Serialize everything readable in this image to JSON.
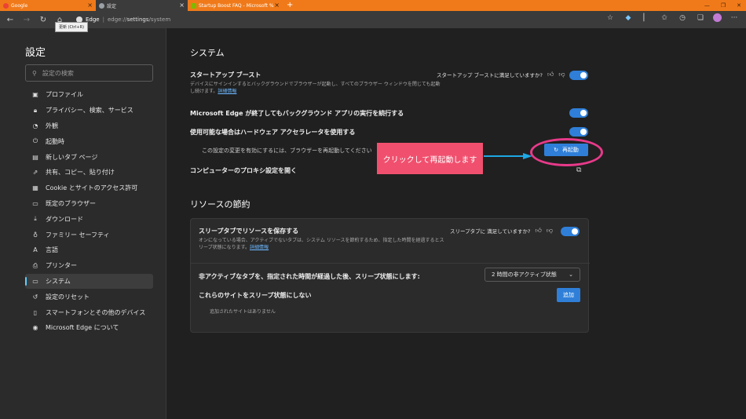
{
  "tabs": [
    {
      "label": "Google",
      "color": "#ea4335"
    },
    {
      "label": "設定",
      "color": "#9aa0a6"
    },
    {
      "label": "Startup Boost FAQ - Microsoft %",
      "color": "#7fba00"
    }
  ],
  "toolbar": {
    "tooltip": "更新 (Ctrl+R)",
    "brand": "Edge",
    "url_prefix": "edge://",
    "url_host": "settings",
    "url_path": "/system"
  },
  "sidebar": {
    "title": "設定",
    "search_placeholder": "設定の検索",
    "items": [
      {
        "label": "プロファイル"
      },
      {
        "label": "プライバシー、検索、サービス"
      },
      {
        "label": "外観"
      },
      {
        "label": "起動時"
      },
      {
        "label": "新しいタブ ページ"
      },
      {
        "label": "共有、コピー、貼り付け"
      },
      {
        "label": "Cookie とサイトのアクセス許可"
      },
      {
        "label": "既定のブラウザー"
      },
      {
        "label": "ダウンロード"
      },
      {
        "label": "ファミリー セーフティ"
      },
      {
        "label": "言語"
      },
      {
        "label": "プリンター"
      },
      {
        "label": "システム"
      },
      {
        "label": "設定のリセット"
      },
      {
        "label": "スマートフォンとその他のデバイス"
      },
      {
        "label": "Microsoft Edge について"
      }
    ]
  },
  "system": {
    "heading": "システム",
    "startup_boost_title": "スタートアップ ブースト",
    "startup_boost_desc1": "デバイスにサインインするとバックグラウンドでブラウザーが起動し、すべてのブラウザー ウィンドウを閉じても起動",
    "startup_boost_desc2": "し続けます。",
    "learn_more": "詳細情報",
    "startup_boost_feedback": "スタートアップ ブーストに満足していますか?",
    "background_title": "Microsoft Edge が終了してもバックグラウンド アプリの実行を続行する",
    "hw_accel_title": "使用可能な場合はハードウェア アクセラレータを使用する",
    "restart_note": "この設定の変更を有効にするには、ブラウザーを再起動してください",
    "restart_button": "再起動",
    "proxy_title": "コンピューターのプロキシ設定を開く"
  },
  "callout": "クリックして再起動します",
  "resources": {
    "heading": "リソースの節約",
    "sleeping_title": "スリープタブでリソースを保存する",
    "sleeping_desc1": "オンになっている場合、アクティブでないタブは、システム リソースを節約するため、指定した時間を経過するとス",
    "sleeping_desc2": "リープ状態になります。",
    "learn_more": "詳細情報",
    "sleeping_feedback": "スリープタブに 満足していますか?",
    "inactive_label": "非アクティブなタブを、指定された時間が経過した後、スリープ状態にします:",
    "inactive_value": "2 時間の非アクティブ状態",
    "never_sleep_label": "これらのサイトをスリープ状態にしない",
    "add_button": "追加",
    "no_sites": "追加されたサイトはありません"
  },
  "colors": {
    "accent": "#2f7fd8",
    "highlight": "#e83a8a",
    "callout": "#f0506e",
    "arrow": "#1ea7e4"
  }
}
